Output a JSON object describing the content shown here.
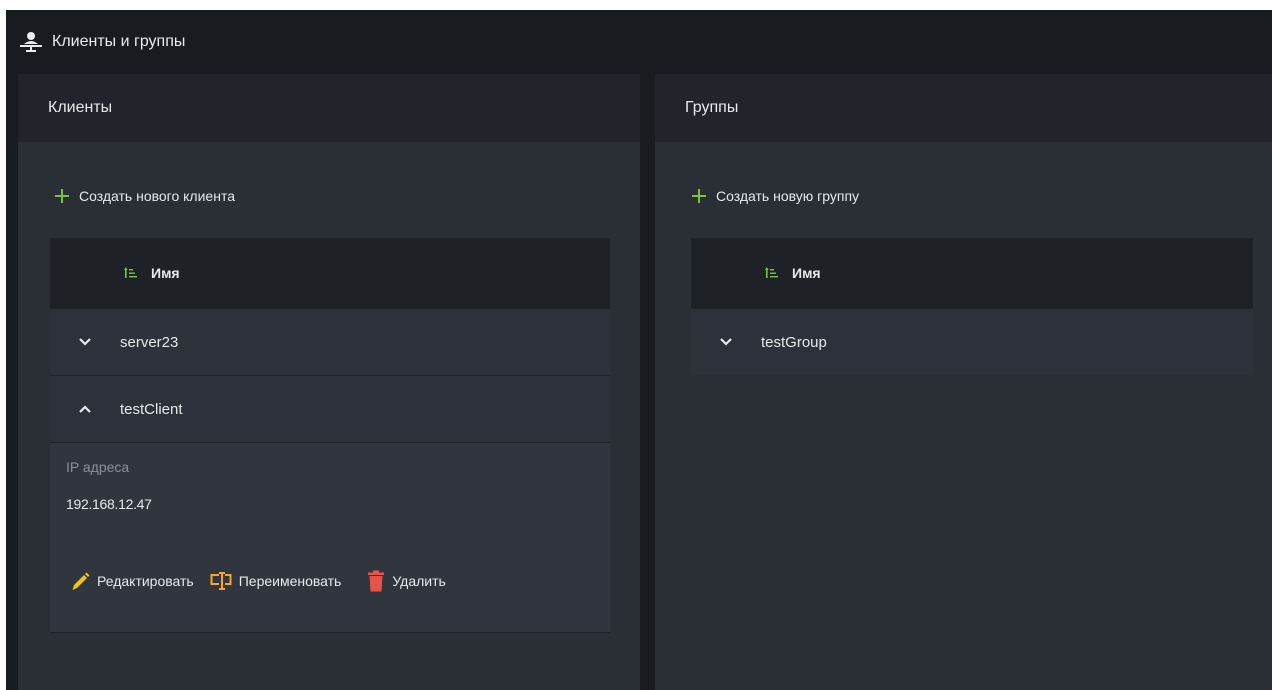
{
  "header": {
    "title": "Клиенты и группы",
    "icon": "user-network-icon"
  },
  "clients": {
    "title": "Клиенты",
    "create_label": "Создать нового клиента",
    "column_name": "Имя",
    "rows": [
      {
        "name": "server23",
        "expanded": false
      },
      {
        "name": "testClient",
        "expanded": true
      }
    ],
    "details": {
      "ip_label": "IP адреса",
      "ip_value": "192.168.12.47",
      "edit_label": "Редактировать",
      "rename_label": "Переименовать",
      "delete_label": "Удалить"
    }
  },
  "groups": {
    "title": "Группы",
    "create_label": "Создать новую группу",
    "column_name": "Имя",
    "rows": [
      {
        "name": "testGroup",
        "expanded": false
      }
    ]
  },
  "colors": {
    "accent_green": "#7ec13b",
    "edit_yellow": "#f0c419",
    "rename_orange": "#f5a623",
    "delete_red": "#e5534b"
  }
}
